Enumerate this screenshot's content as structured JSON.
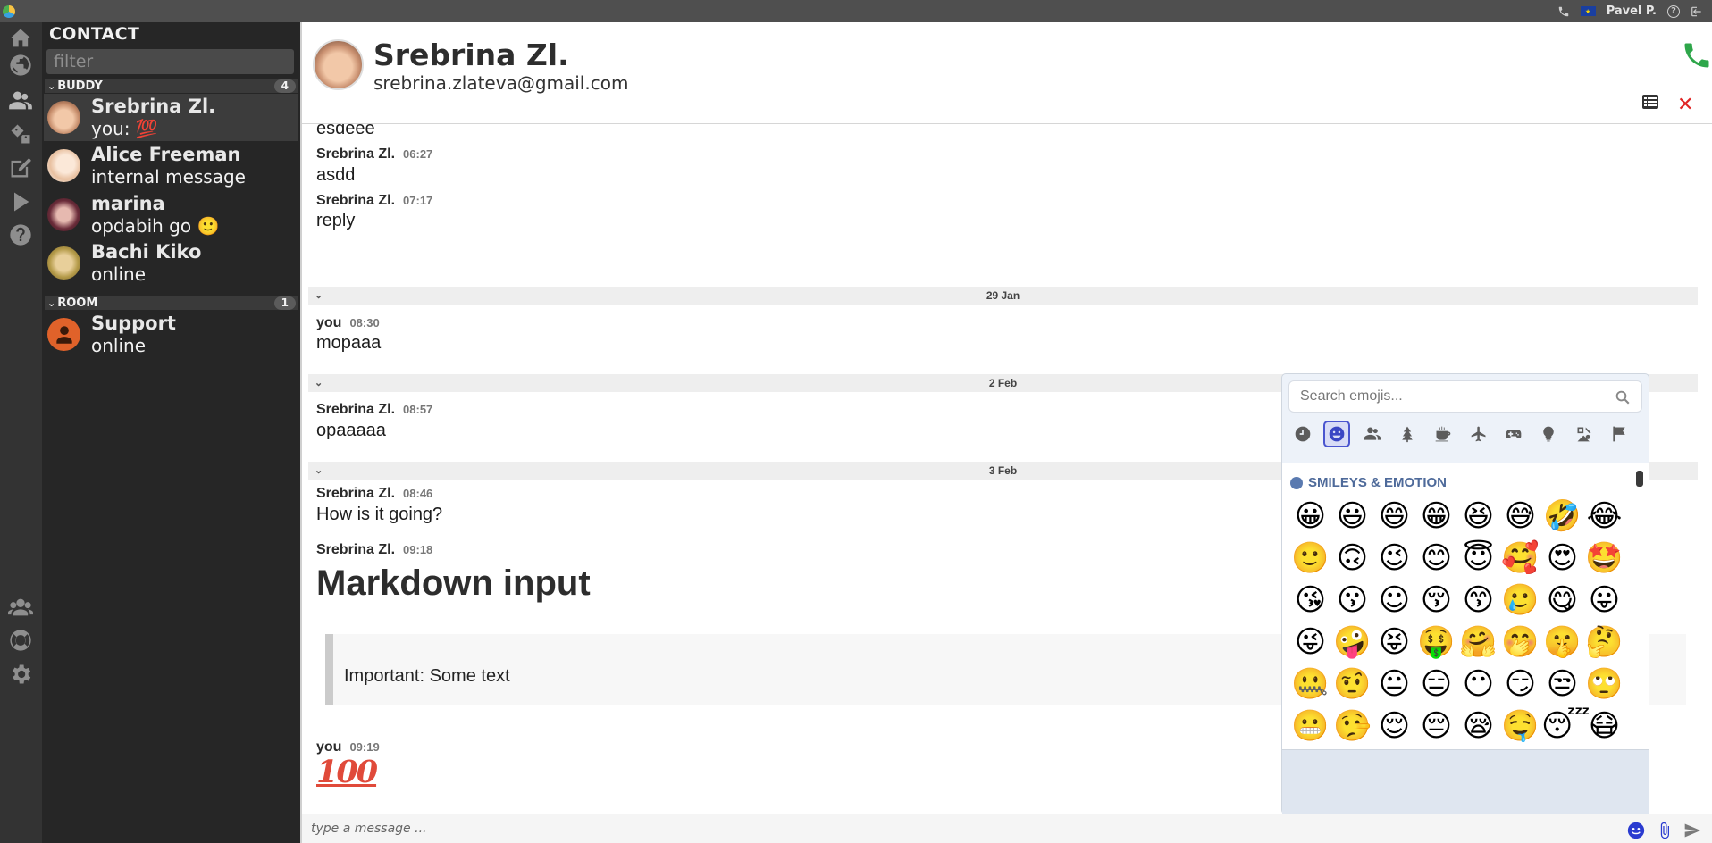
{
  "topbar": {
    "user": "Pavel P.",
    "flag_label": "★"
  },
  "contacts": {
    "title": "CONTACT",
    "filter_placeholder": "filter",
    "buddy_group": {
      "label": "BUDDY",
      "count": "4"
    },
    "room_group": {
      "label": "ROOM",
      "count": "1"
    },
    "buddies": [
      {
        "name": "Srebrina Zl.",
        "status": "you: 💯",
        "active": true
      },
      {
        "name": "Alice Freeman",
        "status": "internal message"
      },
      {
        "name": "marina",
        "status": "opdabih go 🙂"
      },
      {
        "name": "Bachi Kiko",
        "status": "online"
      }
    ],
    "rooms": [
      {
        "name": "Support",
        "status": "online"
      }
    ]
  },
  "chat": {
    "name": "Srebrina Zl.",
    "email": "srebrina.zlateva@gmail.com",
    "messages": [
      {
        "text": "esdeee"
      },
      {
        "sender": "Srebrina Zl.",
        "time": "06:27",
        "text": "asdd"
      },
      {
        "sender": "Srebrina Zl.",
        "time": "07:17",
        "text": "reply"
      },
      {
        "sender": "you",
        "time": "08:30",
        "text": "mopaaa"
      },
      {
        "sender": "Srebrina Zl.",
        "time": "08:57",
        "text": "opaaaaa"
      },
      {
        "sender": "Srebrina Zl.",
        "time": "08:46",
        "text": "How is it going?"
      },
      {
        "sender": "Srebrina Zl.",
        "time": "09:18"
      },
      {
        "sender": "you",
        "time": "09:19",
        "text": "💯"
      }
    ],
    "days": [
      "29 Jan",
      "2 Feb",
      "3 Feb"
    ],
    "markdown_heading": "Markdown input",
    "markdown_quote": "Important: Some text",
    "hundred_text": "100",
    "composer_placeholder": "type a message ..."
  },
  "emoji_picker": {
    "search_placeholder": "Search emojis...",
    "section_title": "SMILEYS & EMOTION",
    "categories": [
      "recent",
      "smileys",
      "people",
      "nature",
      "food",
      "travel",
      "activities",
      "objects",
      "symbols",
      "flags"
    ],
    "selected_category": "smileys",
    "emojis": [
      "😀",
      "😃",
      "😄",
      "😁",
      "😆",
      "😅",
      "🤣",
      "😂",
      "🙂",
      "🙃",
      "😉",
      "😊",
      "😇",
      "🥰",
      "😍",
      "🤩",
      "😘",
      "😗",
      "☺",
      "😚",
      "😙",
      "🥲",
      "😋",
      "😛",
      "😜",
      "🤪",
      "😝",
      "🤑",
      "🤗",
      "🤭",
      "🤫",
      "🤔",
      "🤐",
      "🤨",
      "😐",
      "😑",
      "😶",
      "😏",
      "😒",
      "🙄",
      "😬",
      "🤥",
      "😌",
      "😔",
      "😪",
      "🤤",
      "😴",
      "😷"
    ]
  },
  "colors": {
    "accent": "#4a55cf",
    "call": "#2ea64a",
    "close": "#e02424",
    "rail": "#333333",
    "panel": "#262626"
  }
}
